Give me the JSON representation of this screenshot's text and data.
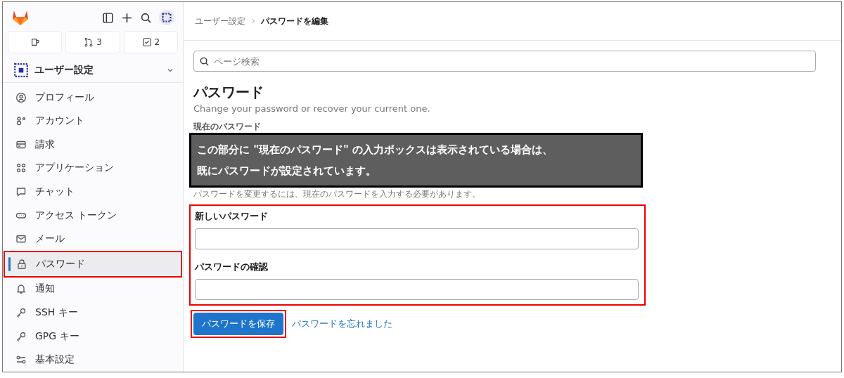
{
  "sidebar": {
    "counters": [
      {
        "kind": "issues"
      },
      {
        "kind": "merge_requests",
        "count": "3"
      },
      {
        "kind": "todos",
        "count": "2"
      }
    ],
    "section": {
      "title": "ユーザー設定",
      "expanded": true
    },
    "items": [
      {
        "label": "プロフィール",
        "selected": false,
        "highlighted": false
      },
      {
        "label": "アカウント",
        "selected": false,
        "highlighted": false
      },
      {
        "label": "請求",
        "selected": false,
        "highlighted": false
      },
      {
        "label": "アプリケーション",
        "selected": false,
        "highlighted": false
      },
      {
        "label": "チャット",
        "selected": false,
        "highlighted": false
      },
      {
        "label": "アクセス トークン",
        "selected": false,
        "highlighted": false
      },
      {
        "label": "メール",
        "selected": false,
        "highlighted": false
      },
      {
        "label": "パスワード",
        "selected": true,
        "highlighted": true
      },
      {
        "label": "通知",
        "selected": false,
        "highlighted": false
      },
      {
        "label": "SSH キー",
        "selected": false,
        "highlighted": false
      },
      {
        "label": "GPG キー",
        "selected": false,
        "highlighted": false
      },
      {
        "label": "基本設定",
        "selected": false,
        "highlighted": false
      }
    ]
  },
  "breadcrumb": [
    {
      "label": "ユーザー設定"
    },
    {
      "label": "パスワードを編集"
    }
  ],
  "search": {
    "placeholder": "ページ検索"
  },
  "page": {
    "title": "パスワード",
    "subtitle": "Change your password or recover your current one."
  },
  "current_password": {
    "label": "現在のパスワード",
    "hint": "パスワードを変更するには、現在のパスワードを入力する必要があります。"
  },
  "callout": {
    "lines": [
      "この部分に \"現在のパスワード\" の入力ボックスは表示されている場合は、",
      "既にパスワードが設定されています。"
    ]
  },
  "new_fields": {
    "highlighted": true,
    "fields": [
      {
        "label": "新しいパスワード"
      },
      {
        "label": "パスワードの確認"
      }
    ]
  },
  "save_button": {
    "label": "パスワードを保存",
    "highlighted": true
  },
  "forgot_link": {
    "label": "パスワードを忘れました"
  }
}
